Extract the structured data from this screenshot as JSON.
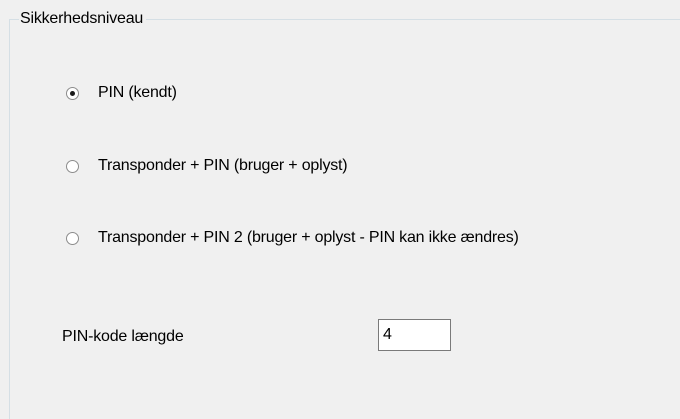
{
  "group": {
    "title": "Sikkerhedsniveau"
  },
  "security_levels": [
    {
      "label": "PIN (kendt)",
      "selected": true
    },
    {
      "label": "Transponder + PIN (bruger + oplyst)",
      "selected": false
    },
    {
      "label": "Transponder + PIN 2 (bruger + oplyst - PIN kan ikke ændres)",
      "selected": false
    }
  ],
  "pin_length": {
    "label": "PIN-kode længde",
    "value": "4"
  }
}
